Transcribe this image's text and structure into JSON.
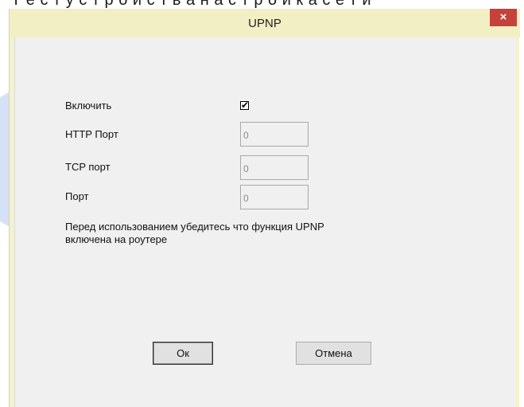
{
  "dialog": {
    "title": "UPNP",
    "close_glyph": "×"
  },
  "form": {
    "enable_label": "Включить",
    "enable_checked": true,
    "check_glyph": "✔",
    "http_port_label": "HTTP Порт",
    "http_port_value": "0",
    "tcp_port_label": "TCP порт",
    "tcp_port_value": "0",
    "port_label": "Порт",
    "port_value": "0",
    "note_line1": "Перед использованием убедитесь что функция UPNP",
    "note_line2": "включена на роутере"
  },
  "buttons": {
    "ok_label": "Ок",
    "cancel_label": "Отмена"
  },
  "colors": {
    "title_bar": "#f2efc5",
    "close_button": "#c7413b",
    "client_background": "#f0f0f0",
    "watermark": "#1f5fd6"
  }
}
